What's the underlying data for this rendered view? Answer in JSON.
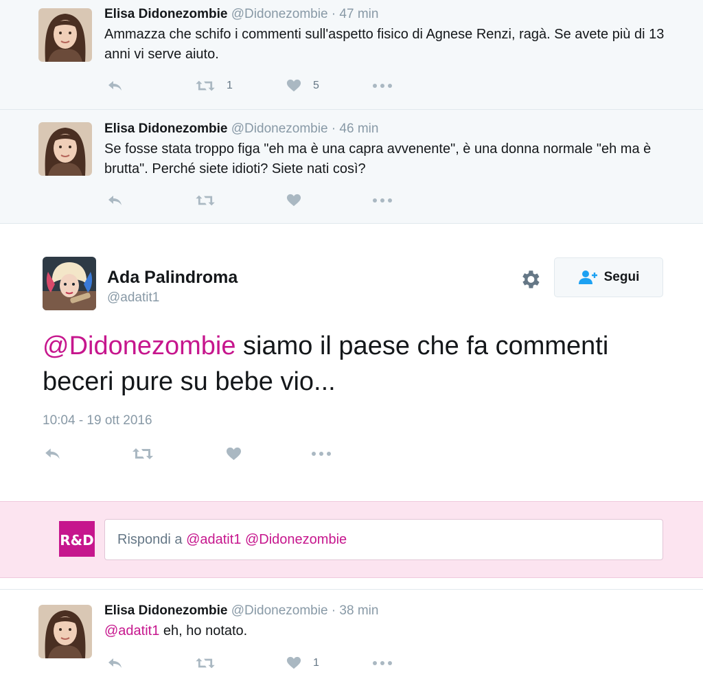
{
  "colors": {
    "mention": "#c6168d",
    "muted": "#8899a6",
    "action_icon": "#aab8c2",
    "reply_bg": "#fce4f0"
  },
  "context_tweets": [
    {
      "name": "Elisa Didonezombie",
      "handle": "@Didonezombie",
      "dot": "·",
      "time": "47 min",
      "text": "Ammazza che schifo i commenti sull'aspetto fisico di Agnese Renzi, ragà. Se avete più di 13 anni vi serve aiuto.",
      "retweets": "1",
      "likes": "5"
    },
    {
      "name": "Elisa Didonezombie",
      "handle": "@Didonezombie",
      "dot": "·",
      "time": "46 min",
      "text": "Se fosse stata troppo figa \"eh ma è una capra avvenente\", è una donna normale \"eh ma è brutta\". Perché siete idioti? Siete nati così?",
      "retweets": "",
      "likes": ""
    }
  ],
  "main_tweet": {
    "name": "Ada Palindroma",
    "handle": "@adatit1",
    "follow_label": "Segui",
    "mention": "@Didonezombie",
    "text": " siamo il paese che fa commenti beceri pure su bebe vio...",
    "timestamp": "10:04 - 19 ott 2016"
  },
  "reply_box": {
    "prefix": "Rispondi a ",
    "mentions": "@adatit1 @Didonezombie",
    "avatar_text": "R&D"
  },
  "reply_tweet": {
    "name": "Elisa Didonezombie",
    "handle": "@Didonezombie",
    "dot": "·",
    "time": "38 min",
    "mention": "@adatit1",
    "text": " eh, ho notato.",
    "likes": "1"
  },
  "icons": [
    "reply-icon",
    "retweet-icon",
    "heart-icon",
    "more-icon",
    "gear-icon",
    "follow-user-icon"
  ]
}
